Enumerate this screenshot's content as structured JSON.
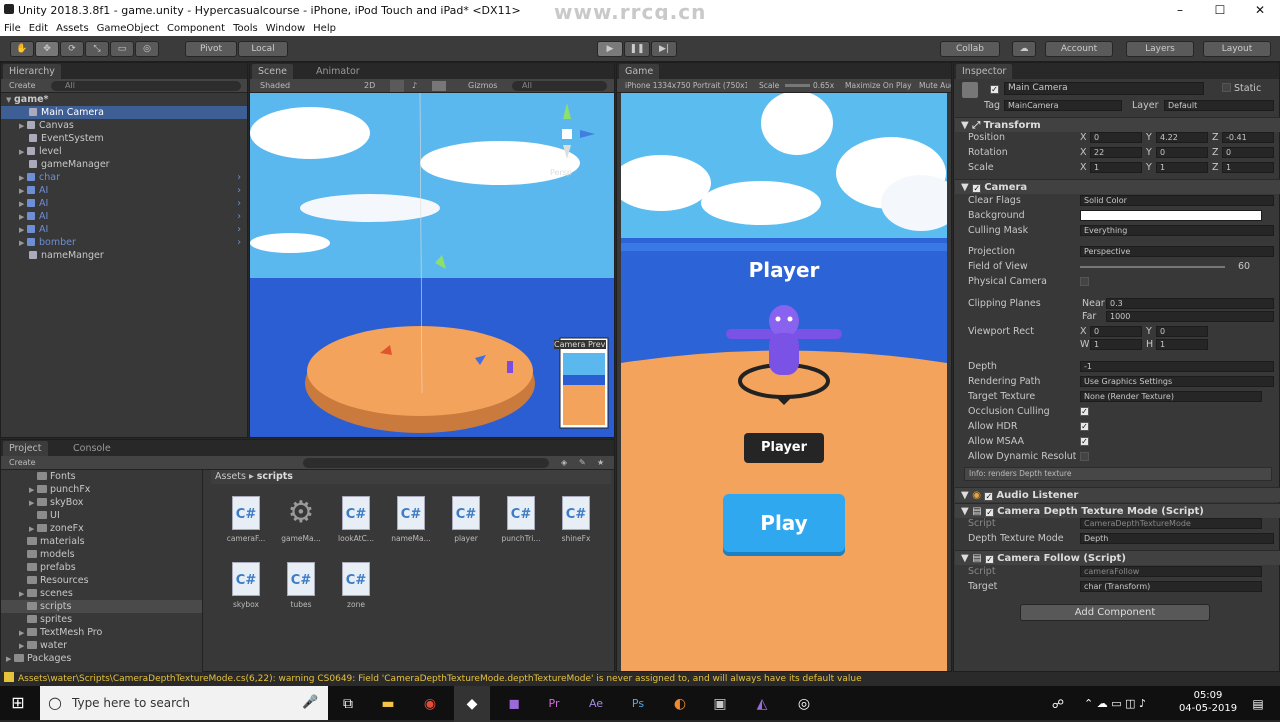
{
  "window": {
    "title": "Unity 2018.3.8f1 - game.unity - Hypercasualcourse - iPhone, iPod Touch and iPad* <DX11>",
    "watermark": "www.rrcg.cn"
  },
  "menu": [
    "File",
    "Edit",
    "Assets",
    "GameObject",
    "Component",
    "Tools",
    "Window",
    "Help"
  ],
  "toolbar": {
    "pivot": "Pivot",
    "local": "Local",
    "collab": "Collab",
    "account": "Account",
    "layers": "Layers",
    "layout": "Layout"
  },
  "hierarchy": {
    "tab": "Hierarchy",
    "create": "Create",
    "search_placeholder": "All",
    "scene": "game*",
    "items": [
      {
        "label": "Main Camera"
      },
      {
        "label": "Canvas"
      },
      {
        "label": "EventSystem"
      },
      {
        "label": "level"
      },
      {
        "label": "gameManager"
      },
      {
        "label": "char"
      },
      {
        "label": "AI"
      },
      {
        "label": "AI"
      },
      {
        "label": "AI"
      },
      {
        "label": "AI"
      },
      {
        "label": "bomber"
      },
      {
        "label": "nameManger"
      }
    ]
  },
  "scene": {
    "tab": "Scene",
    "tab2": "Animator",
    "shading": "Shaded",
    "mode2d": "2D",
    "gizmos": "Gizmos",
    "search": "All",
    "persp": "Persp",
    "preview": "Camera Preview"
  },
  "game": {
    "tab": "Game",
    "resolution": "iPhone 1334x750 Portrait (750x1334)",
    "scale_label": "Scale",
    "scale_value": "0.65x",
    "maximize": "Maximize On Play",
    "mute": "Mute Audio",
    "title_text": "Player",
    "name_label": "Player",
    "play_label": "Play"
  },
  "project": {
    "tab": "Project",
    "tab2": "Console",
    "create": "Create",
    "breadcrumb_root": "Assets",
    "breadcrumb_current": "scripts",
    "tree": [
      {
        "label": "Fonts",
        "indent": 3
      },
      {
        "label": "punchFx",
        "indent": 3
      },
      {
        "label": "skyBox",
        "indent": 3
      },
      {
        "label": "UI",
        "indent": 3
      },
      {
        "label": "zoneFx",
        "indent": 3
      },
      {
        "label": "materials",
        "indent": 2
      },
      {
        "label": "models",
        "indent": 2
      },
      {
        "label": "prefabs",
        "indent": 2
      },
      {
        "label": "Resources",
        "indent": 2
      },
      {
        "label": "scenes",
        "indent": 2
      },
      {
        "label": "scripts",
        "indent": 2
      },
      {
        "label": "sprites",
        "indent": 2
      },
      {
        "label": "TextMesh Pro",
        "indent": 2
      },
      {
        "label": "water",
        "indent": 2
      },
      {
        "label": "Packages",
        "indent": 1
      }
    ],
    "assets": [
      {
        "label": "cameraF...",
        "kind": "cs"
      },
      {
        "label": "gameMa...",
        "kind": "gear"
      },
      {
        "label": "lookAtC...",
        "kind": "cs"
      },
      {
        "label": "nameMa...",
        "kind": "cs"
      },
      {
        "label": "player",
        "kind": "cs"
      },
      {
        "label": "punchTri...",
        "kind": "cs"
      },
      {
        "label": "shineFx",
        "kind": "cs"
      },
      {
        "label": "skybox",
        "kind": "cs"
      },
      {
        "label": "tubes",
        "kind": "cs"
      },
      {
        "label": "zone",
        "kind": "cs"
      }
    ]
  },
  "inspector": {
    "tab": "Inspector",
    "object_name": "Main Camera",
    "static": "Static",
    "tag_label": "Tag",
    "tag_value": "MainCamera",
    "layer_label": "Layer",
    "layer_value": "Default",
    "transform": {
      "title": "Transform",
      "rows": [
        {
          "label": "Position",
          "x": "0",
          "y": "4.22",
          "z": "-0.41"
        },
        {
          "label": "Rotation",
          "x": "22",
          "y": "0",
          "z": "0"
        },
        {
          "label": "Scale",
          "x": "1",
          "y": "1",
          "z": "1"
        }
      ]
    },
    "camera": {
      "title": "Camera",
      "clear_flags": "Clear Flags",
      "clear_flags_v": "Solid Color",
      "background": "Background",
      "culling": "Culling Mask",
      "culling_v": "Everything",
      "projection": "Projection",
      "projection_v": "Perspective",
      "fov": "Field of View",
      "fov_v": "60",
      "physical": "Physical Camera",
      "clipping": "Clipping Planes",
      "near": "Near",
      "near_v": "0.3",
      "far": "Far",
      "far_v": "1000",
      "viewport": "Viewport Rect",
      "vx": "0",
      "vy": "0",
      "vw": "1",
      "vh": "1",
      "depth": "Depth",
      "depth_v": "-1",
      "render_path": "Rendering Path",
      "render_path_v": "Use Graphics Settings",
      "target_tex": "Target Texture",
      "target_tex_v": "None (Render Texture)",
      "occlusion": "Occlusion Culling",
      "hdr": "Allow HDR",
      "msaa": "Allow MSAA",
      "dyn_res": "Allow Dynamic Resolution",
      "info": "Info: renders Depth texture"
    },
    "audio": {
      "title": "Audio Listener"
    },
    "depth_script": {
      "title": "Camera Depth Texture Mode (Script)",
      "script_label": "Script",
      "script_v": "CameraDepthTextureMode",
      "mode_label": "Depth Texture Mode",
      "mode_v": "Depth"
    },
    "follow_script": {
      "title": "Camera Follow (Script)",
      "script_label": "Script",
      "script_v": "cameraFollow",
      "target_label": "Target",
      "target_v": "char (Transform)"
    },
    "add_component": "Add Component"
  },
  "console_msg": "Assets\\water\\Scripts\\CameraDepthTextureMode.cs(6,22): warning CS0649: Field 'CameraDepthTextureMode.depthTextureMode' is never assigned to, and will always have its default value",
  "taskbar": {
    "search_placeholder": "Type here to search",
    "time": "05:09",
    "date": "04-05-2019"
  },
  "colors": {
    "accent": "#3e5f96",
    "play_button": "#2fa8f0",
    "sea": "#2c63d6",
    "island": "#f3a35c",
    "sky": "#5bbcf0"
  }
}
